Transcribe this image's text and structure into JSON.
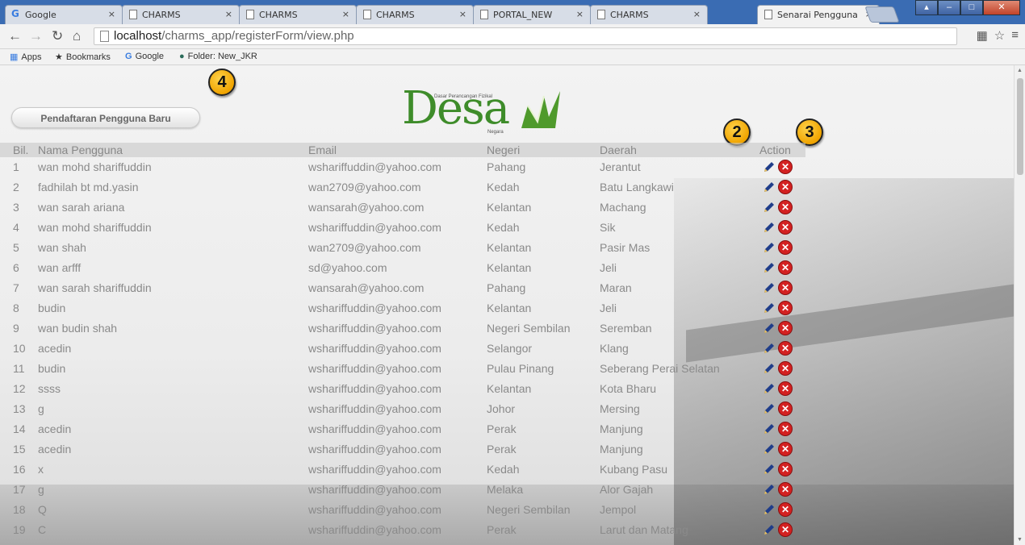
{
  "browser": {
    "tabs": [
      {
        "label": "Google",
        "icon": "google-icon",
        "active": false
      },
      {
        "label": "CHARMS",
        "icon": "page-icon",
        "active": false
      },
      {
        "label": "CHARMS",
        "icon": "page-icon",
        "active": false
      },
      {
        "label": "CHARMS",
        "icon": "page-icon",
        "active": false
      },
      {
        "label": "PORTAL_NEW",
        "icon": "page-icon",
        "active": false
      },
      {
        "label": "CHARMS",
        "icon": "page-icon",
        "active": false
      },
      {
        "label": "Senarai Pengguna",
        "icon": "page-icon",
        "active": true
      }
    ],
    "tab_close": "×",
    "url_host": "localhost",
    "url_path": "/charms_app/registerForm/view.php",
    "bookmarks": [
      {
        "label": "Apps",
        "icon": "apps-grid-icon"
      },
      {
        "label": "Bookmarks",
        "icon": "star-icon"
      },
      {
        "label": "Google",
        "icon": "google-icon"
      },
      {
        "label": "Folder: New_JKR",
        "icon": "globe-icon"
      }
    ]
  },
  "page": {
    "register_button": "Pendaftaran Pengguna Baru",
    "logo": {
      "word": "Desa",
      "tagline": "Dasar Perancangan Fizikal",
      "sub": "Negara"
    },
    "badges": [
      "4",
      "2",
      "3"
    ],
    "columns": [
      "Bil.",
      "Nama Pengguna",
      "Email",
      "Negeri",
      "Daerah",
      "Action"
    ],
    "rows": [
      {
        "no": "1",
        "name": "wan mohd shariffuddin",
        "email": "wshariffuddin@yahoo.com",
        "state": "Pahang",
        "district": "Jerantut"
      },
      {
        "no": "2",
        "name": "fadhilah bt md.yasin",
        "email": "wan2709@yahoo.com",
        "state": "Kedah",
        "district": "Batu Langkawi"
      },
      {
        "no": "3",
        "name": "wan sarah ariana",
        "email": "wansarah@yahoo.com",
        "state": "Kelantan",
        "district": "Machang"
      },
      {
        "no": "4",
        "name": "wan mohd shariffuddin",
        "email": "wshariffuddin@yahoo.com",
        "state": "Kedah",
        "district": "Sik"
      },
      {
        "no": "5",
        "name": "wan shah",
        "email": "wan2709@yahoo.com",
        "state": "Kelantan",
        "district": "Pasir Mas"
      },
      {
        "no": "6",
        "name": "wan arfff",
        "email": "sd@yahoo.com",
        "state": "Kelantan",
        "district": "Jeli"
      },
      {
        "no": "7",
        "name": "wan sarah shariffuddin",
        "email": "wansarah@yahoo.com",
        "state": "Pahang",
        "district": "Maran"
      },
      {
        "no": "8",
        "name": "budin",
        "email": "wshariffuddin@yahoo.com",
        "state": "Kelantan",
        "district": "Jeli"
      },
      {
        "no": "9",
        "name": "wan budin shah",
        "email": "wshariffuddin@yahoo.com",
        "state": "Negeri Sembilan",
        "district": "Seremban"
      },
      {
        "no": "10",
        "name": "acedin",
        "email": "wshariffuddin@yahoo.com",
        "state": "Selangor",
        "district": "Klang"
      },
      {
        "no": "11",
        "name": "budin",
        "email": "wshariffuddin@yahoo.com",
        "state": "Pulau Pinang",
        "district": "Seberang Perai Selatan"
      },
      {
        "no": "12",
        "name": "ssss",
        "email": "wshariffuddin@yahoo.com",
        "state": "Kelantan",
        "district": "Kota Bharu"
      },
      {
        "no": "13",
        "name": "g",
        "email": "wshariffuddin@yahoo.com",
        "state": "Johor",
        "district": "Mersing"
      },
      {
        "no": "14",
        "name": "acedin",
        "email": "wshariffuddin@yahoo.com",
        "state": "Perak",
        "district": "Manjung"
      },
      {
        "no": "15",
        "name": "acedin",
        "email": "wshariffuddin@yahoo.com",
        "state": "Perak",
        "district": "Manjung"
      },
      {
        "no": "16",
        "name": "x",
        "email": "wshariffuddin@yahoo.com",
        "state": "Kedah",
        "district": "Kubang Pasu"
      },
      {
        "no": "17",
        "name": "g",
        "email": "wshariffuddin@yahoo.com",
        "state": "Melaka",
        "district": "Alor Gajah"
      },
      {
        "no": "18",
        "name": "Q",
        "email": "wshariffuddin@yahoo.com",
        "state": "Negeri Sembilan",
        "district": "Jempol"
      },
      {
        "no": "19",
        "name": "C",
        "email": "wshariffuddin@yahoo.com",
        "state": "Perak",
        "district": "Larut dan Matang"
      }
    ]
  }
}
